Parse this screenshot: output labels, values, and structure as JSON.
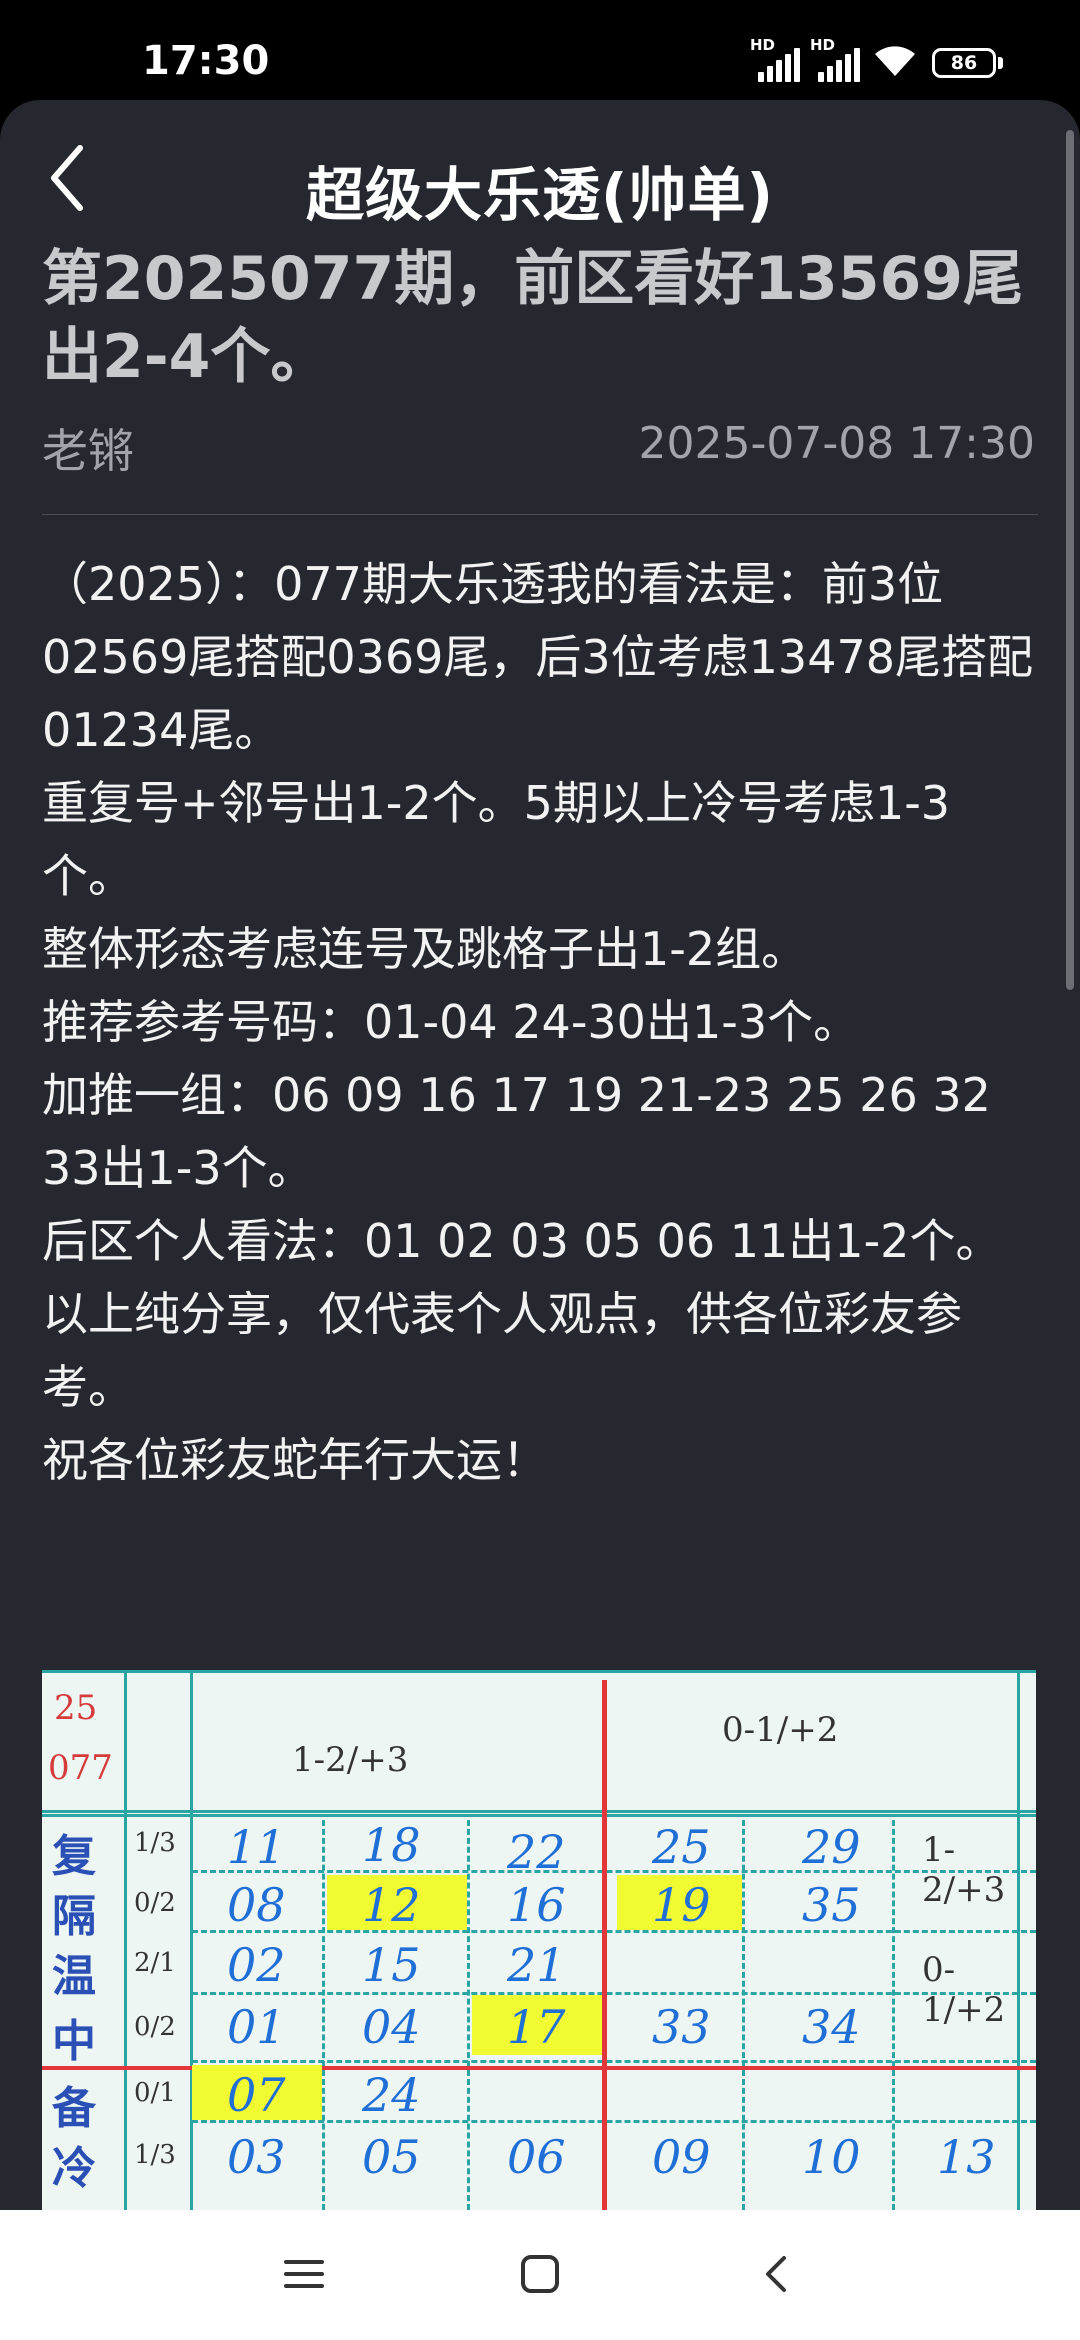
{
  "status_bar": {
    "time": "17:30",
    "signal1_label": "HD",
    "signal2_label": "HD",
    "battery": "86",
    "icons": [
      "signal-icon",
      "signal-icon",
      "wifi-icon",
      "battery-icon"
    ]
  },
  "header": {
    "title": "超级大乐透(帅单)",
    "back_icon": "chevron-left-icon"
  },
  "article": {
    "title": "第2025077期，前区看好13569尾出2-4个。",
    "author": "老锵",
    "date": "2025-07-08 17:30",
    "paragraphs": [
      "（2025）：077期大乐透我的看法是：前3位02569尾搭配0369尾，后3位考虑13478尾搭配01234尾。",
      "重复号+邻号出1-2个。5期以上冷号考虑1-3个。",
      "整体形态考虑连号及跳格子出1-2组。",
      "推荐参考号码：01-04 24-30出1-3个。",
      "加推一组：06 09 16 17 19 21-23 25 26 32 33出1-3个。",
      "后区个人看法：01 02 03 05 06 11出1-2个。",
      "以上纯分享，仅代表个人观点，供各位彩友参考。",
      "祝各位彩友蛇年行大运！"
    ]
  },
  "photo": {
    "corner_top": "25",
    "corner_bottom": "077",
    "head_left": "1-2/+3",
    "head_right": "0-1/+2",
    "rows": [
      {
        "label": "复",
        "ratio": "1/3",
        "nums": [
          "11",
          "18",
          "22",
          "25",
          "29"
        ],
        "note": "1-2/+3"
      },
      {
        "label": "隔",
        "ratio": "0/2",
        "nums": [
          "08",
          "12",
          "16",
          "19",
          "35"
        ],
        "note": ""
      },
      {
        "label": "温",
        "ratio": "2/1",
        "nums": [
          "02",
          "15",
          "21",
          "",
          ""
        ],
        "note": "0-1/+2"
      },
      {
        "label": "中",
        "ratio": "0/2",
        "nums": [
          "01",
          "04",
          "17",
          "33",
          "34"
        ],
        "note": ""
      },
      {
        "label": "备",
        "ratio": "0/1",
        "nums": [
          "07",
          "24",
          "",
          "",
          ""
        ],
        "note": ""
      },
      {
        "label": "冷",
        "ratio": "1/3",
        "nums": [
          "03",
          "05",
          "06",
          "09",
          "10"
        ],
        "note": "13"
      }
    ]
  },
  "nav": {
    "menu_icon": "menu-icon",
    "home_icon": "home-square-icon",
    "back_icon": "back-chevron-icon"
  }
}
